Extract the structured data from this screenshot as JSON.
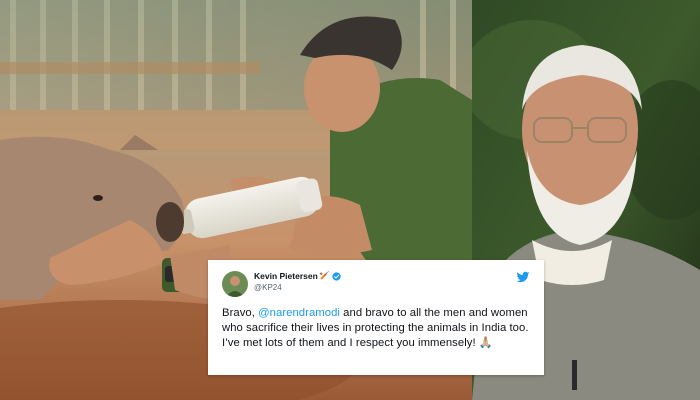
{
  "tweet": {
    "display_name": "Kevin Pietersen",
    "name_emoji": "🏏",
    "handle": "@KP24",
    "text_before": "Bravo, ",
    "mention": "@narendramodi",
    "text_after": " and bravo to all the men and women who sacrifice their lives in protecting the animals in India too. I’ve met lots of them and I respect you immensely! ",
    "end_emoji": "🙏🏼"
  },
  "icons": {
    "verified": "verified-badge-icon",
    "platform": "twitter-bird-icon",
    "name_emoji": "cricket-bat-icon",
    "end_emoji": "folded-hands-icon"
  },
  "colors": {
    "mention": "#1d9bf0",
    "verified": "#1d9bf0",
    "twitter_brand": "#1d9bf0",
    "card_bg": "#ffffff"
  }
}
